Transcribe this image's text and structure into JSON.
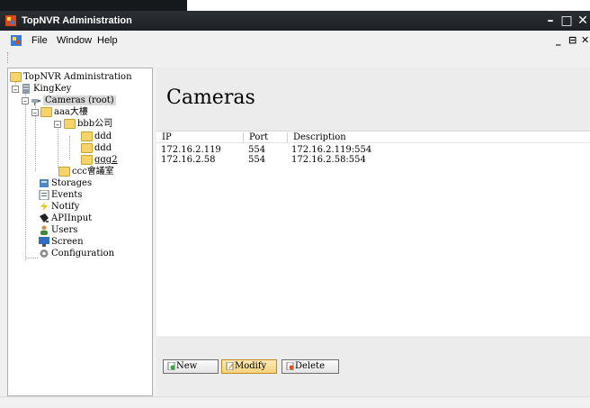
{
  "window": {
    "title": "TopNVR Administration"
  },
  "menu": {
    "items": [
      "File",
      "Window",
      "Help"
    ]
  },
  "tree": {
    "root": "TopNVR Administration",
    "server": "KingKey",
    "cameras": "Cameras (root)",
    "folder_aaa": "aaa大樓",
    "folder_bbb": "bbb公司",
    "ddd1": "ddd",
    "ddd2": "ddd",
    "ggg2": "ggg2",
    "folder_ccc": "ccc會議室",
    "storages": "Storages",
    "events": "Events",
    "notify": "Notify",
    "apiinput": "APIInput",
    "users": "Users",
    "screen": "Screen",
    "configuration": "Configuration"
  },
  "page": {
    "title": "Cameras"
  },
  "table": {
    "columns": [
      "IP",
      "Port",
      "Description"
    ],
    "rows": [
      {
        "ip": "172.16.2.119",
        "port": "554",
        "desc": "172.16.2.119:554"
      },
      {
        "ip": "172.16.2.58",
        "port": "554",
        "desc": "172.16.2.58:554"
      }
    ]
  },
  "buttons": {
    "new": "New",
    "modify": "Modify",
    "delete": "Delete"
  }
}
